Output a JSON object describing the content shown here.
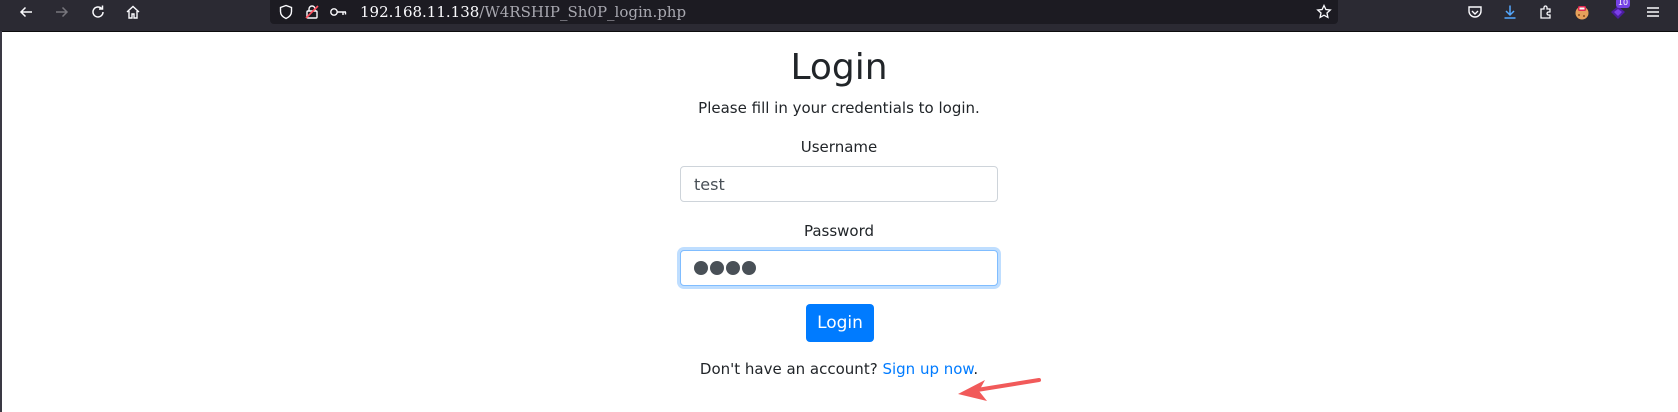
{
  "browser": {
    "url_host": "192.168.11.138",
    "url_path": "/W4RSHIP_Sh0P_login.php",
    "extension_badge": "10"
  },
  "page": {
    "title": "Login",
    "subtitle": "Please fill in your credentials to login.",
    "username_label": "Username",
    "username_value": "test",
    "password_label": "Password",
    "password_length": 4,
    "login_button": "Login",
    "signup_prompt": "Don't have an account?",
    "signup_link": "Sign up now",
    "signup_suffix": "."
  },
  "colors": {
    "primary": "#007bff",
    "annotation_arrow": "#f15a5a"
  }
}
